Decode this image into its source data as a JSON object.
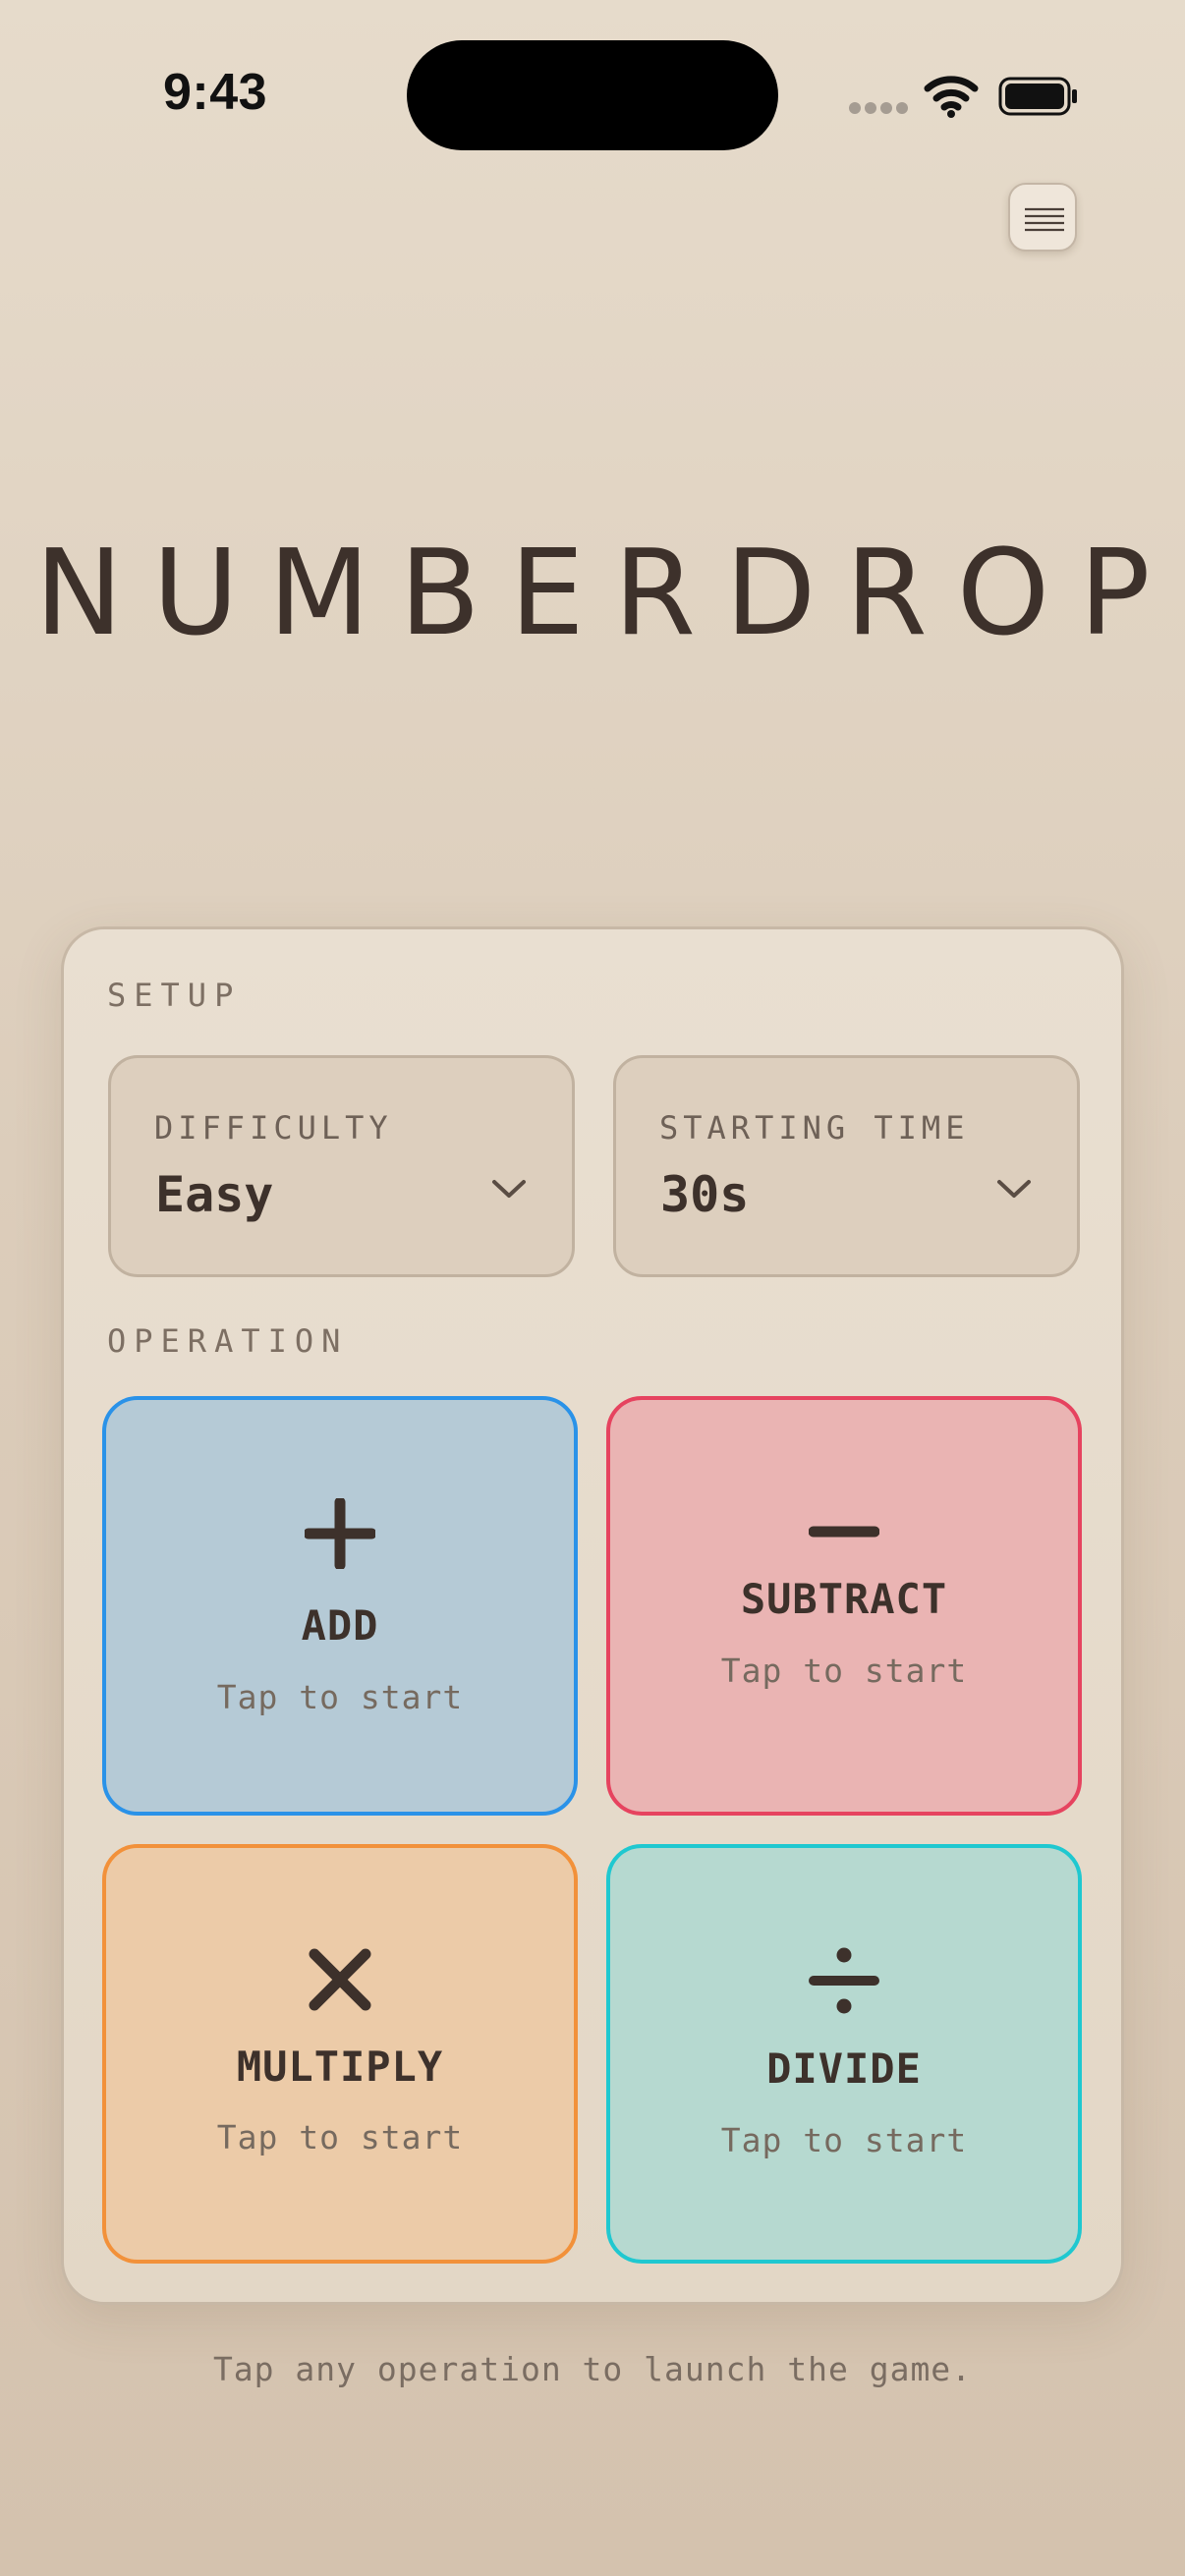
{
  "status_bar": {
    "time": "9:43"
  },
  "header": {
    "app_title": "NUMBERDROP",
    "menu_icon": "hamburger-menu-icon"
  },
  "setup": {
    "section_label": "SETUP",
    "difficulty": {
      "label": "DIFFICULTY",
      "value": "Easy"
    },
    "starting_time": {
      "label": "STARTING TIME",
      "value": "30s"
    }
  },
  "operation": {
    "section_label": "OPERATION",
    "tiles": [
      {
        "name": "ADD",
        "hint": "Tap to start",
        "icon": "plus-icon",
        "color": "#2a92e8",
        "fill": "#b5cad6"
      },
      {
        "name": "SUBTRACT",
        "hint": "Tap to start",
        "icon": "minus-icon",
        "color": "#e6435f",
        "fill": "#eab4b3"
      },
      {
        "name": "MULTIPLY",
        "hint": "Tap to start",
        "icon": "multiply-icon",
        "color": "#f2913a",
        "fill": "#eccba8"
      },
      {
        "name": "DIVIDE",
        "hint": "Tap to start",
        "icon": "divide-icon",
        "color": "#1fc8d0",
        "fill": "#b6d9d0"
      }
    ]
  },
  "footer": {
    "hint": "Tap any operation to launch the game."
  }
}
